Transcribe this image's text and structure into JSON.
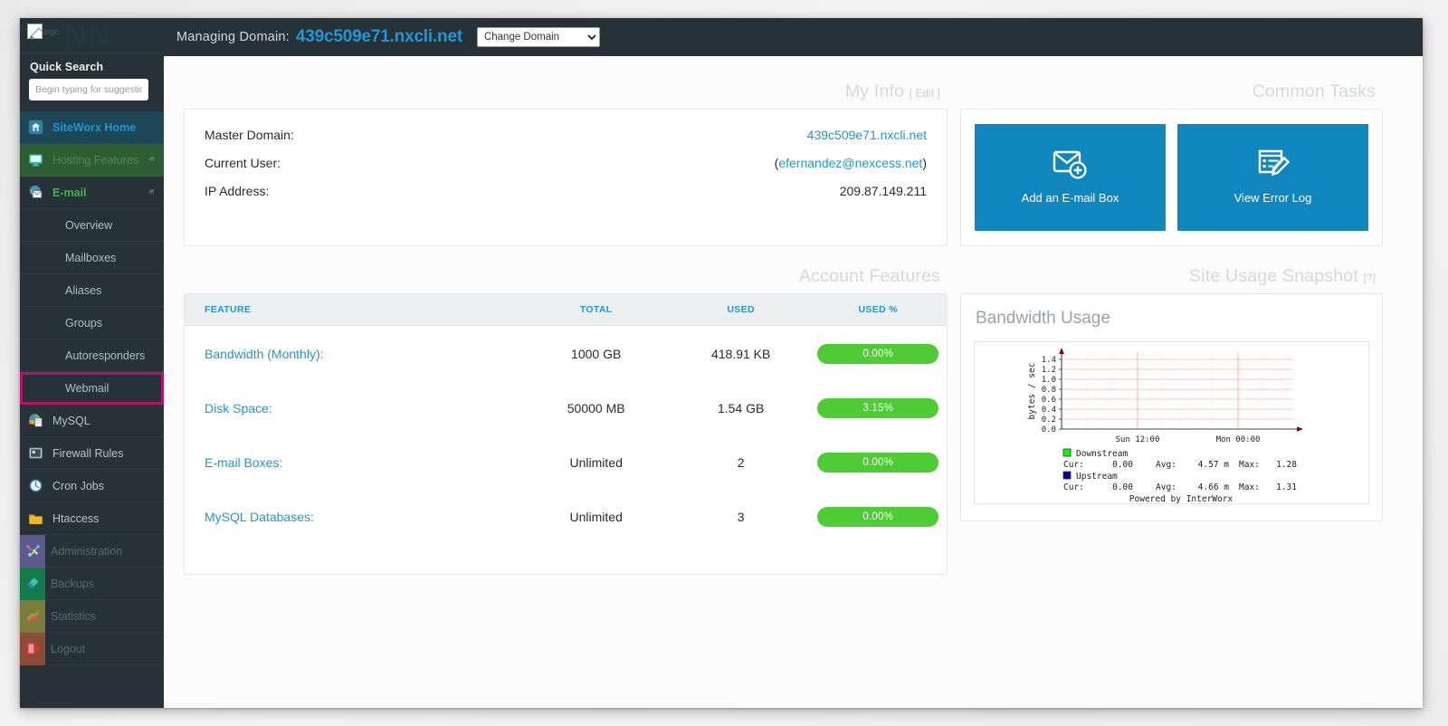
{
  "colors": {
    "sidebar_bg": "#263238",
    "accent_blue": "#2196d4",
    "button_blue": "#1086bf",
    "pill_green": "#4ecb35",
    "highlight_magenta": "#b5136e",
    "nav_green": "#4caf50"
  },
  "sidebar": {
    "logo_alt": "logo",
    "watermark": "NN",
    "quick_search": {
      "label": "Quick Search",
      "placeholder": "Begin typing for suggestions",
      "value": ""
    },
    "items": [
      {
        "label": "SiteWorx Home",
        "icon": "home-icon",
        "state": "active",
        "caret": ""
      },
      {
        "label": "Hosting Features",
        "icon": "monitor-icon",
        "state": "open-section",
        "caret": "ⱏ"
      },
      {
        "label": "E-mail",
        "icon": "mail-icon",
        "state": "open-group",
        "caret": "ⱏ"
      }
    ],
    "email_subitems": [
      {
        "label": "Overview",
        "highlighted": false
      },
      {
        "label": "Mailboxes",
        "highlighted": false
      },
      {
        "label": "Aliases",
        "highlighted": false
      },
      {
        "label": "Groups",
        "highlighted": false
      },
      {
        "label": "Autoresponders",
        "highlighted": false
      },
      {
        "label": "Webmail",
        "highlighted": true
      }
    ],
    "items_lower": [
      {
        "label": "MySQL",
        "icon": "database-icon",
        "caret": "ⱟ",
        "boxed": false,
        "dim": false
      },
      {
        "label": "Firewall Rules",
        "icon": "firewall-icon",
        "caret": "",
        "boxed": false,
        "dim": false
      },
      {
        "label": "Cron Jobs",
        "icon": "clock-icon",
        "caret": "",
        "boxed": false,
        "dim": false
      },
      {
        "label": "Htaccess",
        "icon": "folder-icon",
        "caret": "",
        "boxed": false,
        "dim": false
      },
      {
        "label": "Administration",
        "icon": "tools-icon",
        "caret": "ⱟ",
        "boxed": true,
        "dim": true
      },
      {
        "label": "Backups",
        "icon": "backup-icon",
        "caret": "ⱟ",
        "boxed": true,
        "dim": true
      },
      {
        "label": "Statistics",
        "icon": "statistics-icon",
        "caret": "ⱟ",
        "boxed": true,
        "dim": true
      },
      {
        "label": "Logout",
        "icon": "logout-icon",
        "caret": "",
        "boxed": true,
        "dim": true
      }
    ]
  },
  "topbar": {
    "managing_label": "Managing Domain:",
    "domain": "439c509e71.nxcli.net",
    "change_domain_selected": "Change Domain",
    "change_domain_options": [
      "Change Domain"
    ]
  },
  "my_info": {
    "title": "My Info",
    "edit_label": "[ Edit ]",
    "rows": [
      {
        "key": "Master Domain:",
        "value": "439c509e71.nxcli.net",
        "is_link": true,
        "wrapped": false
      },
      {
        "key": "Current User:",
        "value": "efernandez@nexcess.net",
        "is_link": true,
        "wrapped": true
      },
      {
        "key": "IP Address:",
        "value": "209.87.149.211",
        "is_link": false,
        "wrapped": false
      }
    ]
  },
  "account_features": {
    "title": "Account Features",
    "columns": [
      "FEATURE",
      "TOTAL",
      "USED",
      "USED %"
    ],
    "rows": [
      {
        "feature": "Bandwidth (Monthly):",
        "total": "1000 GB",
        "used": "418.91 KB",
        "used_pct": "0.00%"
      },
      {
        "feature": "Disk Space:",
        "total": "50000 MB",
        "used": "1.54 GB",
        "used_pct": "3.15%"
      },
      {
        "feature": "E-mail Boxes:",
        "total": "Unlimited",
        "used": "2",
        "used_pct": "0.00%"
      },
      {
        "feature": "MySQL Databases:",
        "total": "Unlimited",
        "used": "3",
        "used_pct": "0.00%"
      }
    ]
  },
  "common_tasks": {
    "title": "Common Tasks",
    "buttons": [
      {
        "label": "Add an E-mail Box",
        "icon": "envelope-plus-icon"
      },
      {
        "label": "View Error Log",
        "icon": "document-edit-icon"
      }
    ]
  },
  "site_usage": {
    "title": "Site Usage Snapshot",
    "help": "[?]",
    "graph_title": "Bandwidth Usage"
  },
  "chart_data": {
    "type": "line",
    "title": "Bandwidth Usage",
    "ylabel": "bytes / sec",
    "xlabel": "",
    "ylim": [
      0.0,
      1.5
    ],
    "yticks": [
      "1.4",
      "1.2",
      "1.0",
      "0.8",
      "0.6",
      "0.4",
      "0.2",
      "0.0"
    ],
    "xticks": [
      "Sun 12:00",
      "Mon 00:00"
    ],
    "grid": true,
    "series": [
      {
        "name": "Downstream",
        "color": "#00ff00",
        "values": [],
        "cur": "0.00",
        "avg": "4.57 m",
        "max": "1.28"
      },
      {
        "name": "Upstream",
        "color": "#000099",
        "values": [],
        "cur": "0.00",
        "avg": "4.66 m",
        "max": "1.31"
      }
    ],
    "legend_labels": {
      "cur": "Cur:",
      "avg": "Avg:",
      "max": "Max:"
    },
    "footer": "Powered by InterWorx"
  }
}
